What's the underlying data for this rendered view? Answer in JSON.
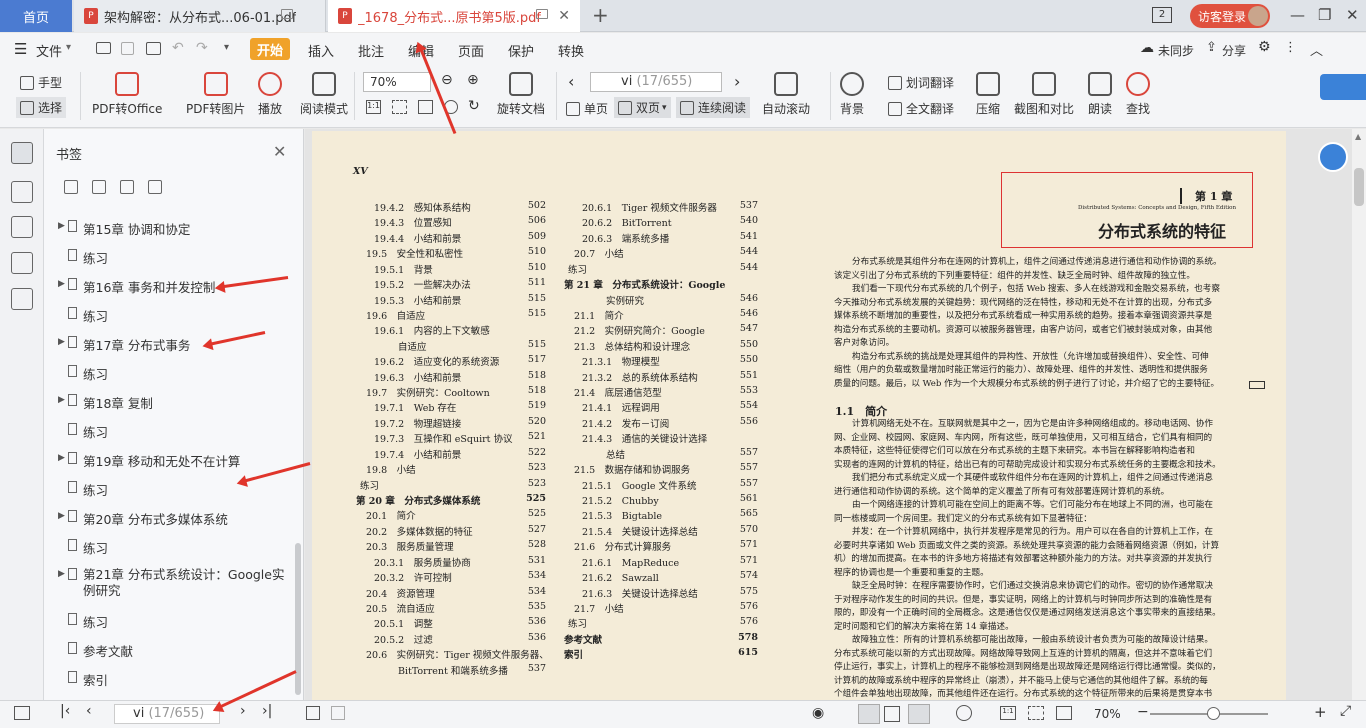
{
  "tabs": {
    "home": "首页",
    "tab1": "架构解密：从分布式...06-01.pdf",
    "tab2": "_1678_分布式...原书第5版.pdf",
    "new_tab": "+",
    "login": "访客登录",
    "window_count": "2"
  },
  "menu": {
    "file": "文件",
    "items": [
      "开始",
      "插入",
      "批注",
      "编辑",
      "页面",
      "保护",
      "转换"
    ],
    "unsync": "未同步",
    "share": "分享"
  },
  "toolbar": {
    "hand": "手型",
    "select": "选择",
    "pdf_office": "PDF转Office",
    "pdf_image": "PDF转图片",
    "play": "播放",
    "read_mode": "阅读模式",
    "zoom": "70%",
    "rotate": "旋转文档",
    "page_current": "vi",
    "page_total": "(17/655)",
    "single": "单页",
    "double": "双页",
    "continuous": "连续阅读",
    "auto_scroll": "自动滚动",
    "background": "背景",
    "word_translate": "划词翻译",
    "full_translate": "全文翻译",
    "compress": "压缩",
    "crop_compare": "截图和对比",
    "read_aloud": "朗读",
    "search": "查找"
  },
  "bookmarks": {
    "title": "书签",
    "items": [
      {
        "label": "第15章 协调和协定",
        "expandable": true
      },
      {
        "label": "练习",
        "expandable": false
      },
      {
        "label": "第16章 事务和并发控制",
        "expandable": true
      },
      {
        "label": "练习",
        "expandable": false
      },
      {
        "label": "第17章 分布式事务",
        "expandable": true
      },
      {
        "label": "练习",
        "expandable": false
      },
      {
        "label": "第18章 复制",
        "expandable": true
      },
      {
        "label": "练习",
        "expandable": false
      },
      {
        "label": "第19章 移动和无处不在计算",
        "expandable": true
      },
      {
        "label": "练习",
        "expandable": false
      },
      {
        "label": "第20章 分布式多媒体系统",
        "expandable": true
      },
      {
        "label": "练习",
        "expandable": false
      },
      {
        "label": "第21章 分布式系统设计：Google实",
        "label2": "例研究",
        "expandable": true
      },
      {
        "label": "练习",
        "expandable": false
      },
      {
        "label": "参考文献",
        "expandable": false
      },
      {
        "label": "索引",
        "expandable": false
      }
    ]
  },
  "left_page": {
    "page_no": "XV",
    "col1": [
      [
        "19.4.2　感知体系结构",
        "502"
      ],
      [
        "19.4.3　位置感知",
        "506"
      ],
      [
        "19.4.4　小结和前景",
        "509"
      ],
      [
        "19.5　安全性和私密性",
        "510"
      ],
      [
        "19.5.1　背景",
        "510"
      ],
      [
        "19.5.2　一些解决办法",
        "511"
      ],
      [
        "19.5.3　小结和前景",
        "515"
      ],
      [
        "19.6　自适应",
        "515"
      ],
      [
        "19.6.1　内容的上下文敏感",
        ""
      ],
      [
        "自适应",
        "515"
      ],
      [
        "19.6.2　适应变化的系统资源",
        "517"
      ],
      [
        "19.6.3　小结和前景",
        "518"
      ],
      [
        "19.7　实例研究：Cooltown",
        "518"
      ],
      [
        "19.7.1　Web 存在",
        "519"
      ],
      [
        "19.7.2　物理超链接",
        "520"
      ],
      [
        "19.7.3　互操作和 eSquirt 协议",
        "521"
      ],
      [
        "19.7.4　小结和前景",
        "522"
      ],
      [
        "19.8　小结",
        "523"
      ],
      [
        "练习",
        "523"
      ],
      [
        "第 20 章　分布式多媒体系统",
        "525"
      ],
      [
        "20.1　简介",
        "525"
      ],
      [
        "20.2　多媒体数据的特征",
        "527"
      ],
      [
        "20.3　服务质量管理",
        "528"
      ],
      [
        "20.3.1　服务质量协商",
        "531"
      ],
      [
        "20.3.2　许可控制",
        "534"
      ],
      [
        "20.4　资源管理",
        "534"
      ],
      [
        "20.5　流自适应",
        "535"
      ],
      [
        "20.5.1　调整",
        "536"
      ],
      [
        "20.5.2　过滤",
        "536"
      ],
      [
        "20.6　实例研究：Tiger 视频文件服务器、",
        ""
      ],
      [
        "BitTorrent 和端系统多播",
        "537"
      ]
    ],
    "col2": [
      [
        "20.6.1　Tiger 视频文件服务器",
        "537"
      ],
      [
        "20.6.2　BitTorrent",
        "540"
      ],
      [
        "20.6.3　端系统多播",
        "541"
      ],
      [
        "20.7　小结",
        "544"
      ],
      [
        "练习",
        "544"
      ],
      [
        "第 21 章　分布式系统设计：Google",
        ""
      ],
      [
        "实例研究",
        "546"
      ],
      [
        "21.1　简介",
        "546"
      ],
      [
        "21.2　实例研究简介：Google",
        "547"
      ],
      [
        "21.3　总体结构和设计理念",
        "550"
      ],
      [
        "21.3.1　物理模型",
        "550"
      ],
      [
        "21.3.2　总的系统体系结构",
        "551"
      ],
      [
        "21.4　底层通信范型",
        "553"
      ],
      [
        "21.4.1　远程调用",
        "554"
      ],
      [
        "21.4.2　发布－订阅",
        "556"
      ],
      [
        "21.4.3　通信的关键设计选择",
        ""
      ],
      [
        "总结",
        "557"
      ],
      [
        "21.5　数据存储和协调服务",
        "557"
      ],
      [
        "21.5.1　Google 文件系统",
        "557"
      ],
      [
        "21.5.2　Chubby",
        "561"
      ],
      [
        "21.5.3　Bigtable",
        "565"
      ],
      [
        "21.5.4　关键设计选择总结",
        "570"
      ],
      [
        "21.6　分布式计算服务",
        "571"
      ],
      [
        "21.6.1　MapReduce",
        "571"
      ],
      [
        "21.6.2　Sawzall",
        "574"
      ],
      [
        "21.6.3　关键设计选择总结",
        "575"
      ],
      [
        "21.7　小结",
        "576"
      ],
      [
        "练习",
        "576"
      ],
      [
        "参考文献",
        "578"
      ],
      [
        "索引",
        "615"
      ]
    ]
  },
  "right_page": {
    "chapter": "第 1 章",
    "edition_line": "Distributed Systems: Concepts and Design, Fifth Edition",
    "chapter_title": "分布式系统的特征",
    "section": "1.1　简介",
    "lines": [
      "分布式系统是其组件分布在连网的计算机上，组件之间通过传递消息进行通信和动作协调的系统。",
      "该定义引出了分布式系统的下列重要特征：组件的并发性、缺乏全局时钟、组件故障的独立性。",
      "我们看一下现代分布式系统的几个例子，包括 Web 搜索、多人在线游戏和金融交易系统，也考察",
      "今天推动分布式系统发展的关键趋势：现代网络的泛在特性，移动和无处不在计算的出现，分布式多",
      "媒体系统不断增加的重要性，以及把分布式系统看成一种实用系统的趋势。接着本章强调资源共享是",
      "构造分布式系统的主要动机。资源可以被服务器管理，由客户访问，或者它们被封装成对象，由其他",
      "客户对象访问。",
      "构造分布式系统的挑战是处理其组件的异构性、开放性（允许增加或替换组件）、安全性、可伸",
      "缩性（用户的负载或数量增加时能正常运行的能力）、故障处理、组件的并发性、透明性和提供服务",
      "质量的问题。最后，以 Web 作为一个大规模分布式系统的例子进行了讨论，并介绍了它的主要特征。",
      "计算机网络无处不在。互联网就是其中之一，因为它是由许多种网络组成的。移动电话网、协作",
      "网、企业网、校园网、家庭网、车内网，所有这些，既可单独使用，又可相互结合，它们具有相同的",
      "本质特征，这些特征使得它们可以放在分布式系统的主题下来研究。本书旨在解释影响构造者和",
      "实现者的连网的计算机的特征，给出已有的可帮助完成设计和实现分布式系统任务的主要概念和技术。",
      "我们把分布式系统定义成一个其硬件或软件组件分布在连网的计算机上，组件之间通过传递消息",
      "进行通信和动作协调的系统。这个简单的定义覆盖了所有可有效部署连网计算机的系统。",
      "由一个网络连接的计算机可能在空间上的距离不等。它们可能分布在地球上不同的洲，也可能在",
      "同一栋楼或同一个房间里。我们定义的分布式系统有如下显著特征：",
      "并发：在一个计算机网络中，执行并发程序是常见的行为。用户可以在各自的计算机上工作，在",
      "必要时共享诸如 Web 页面或文件之类的资源。系统处理共享资源的能力会随着网络资源（例如，计算",
      "机）的增加而提高。在本书的许多地方将描述有效部署这种额外能力的方法。对共享资源的并发执行",
      "程序的协调也是一个重要和重复的主题。",
      "缺乏全局时钟：在程序需要协作时，它们通过交换消息来协调它们的动作。密切的协作通常取决",
      "于对程序动作发生的时间的共识。但是，事实证明，网络上的计算机与时钟同步所达到的准确性是有",
      "限的，即没有一个正确时间的全局概念。这是通信仅仅是通过网络发送消息这个事实带来的直接结果。",
      "定时问题和它们的解决方案将在第 14 章描述。",
      "故障独立性：所有的计算机系统都可能出故障，一般由系统设计者负责为可能的故障设计结果。",
      "分布式系统可能以新的方式出现故障。网络故障导致网上互连的计算机的隔离，但这并不意味着它们",
      "停止运行，事实上，计算机上的程序不能够检测到网络是出现故障还是网络运行得比通常慢。类似的，",
      "计算机的故障或系统中程序的异常终止（崩溃），并不能马上使与它通信的其他组件了解。系统的每",
      "个组件会单独地出现故障，而其他组件还在运行。分布式系统的这个特征所带来的后果将是贯穿本书"
    ]
  },
  "status": {
    "page_current": "vi",
    "page_total": "(17/655)",
    "zoom": "70%"
  },
  "accent_red": "#e0352b",
  "accent_blue": "#4b7bd1"
}
